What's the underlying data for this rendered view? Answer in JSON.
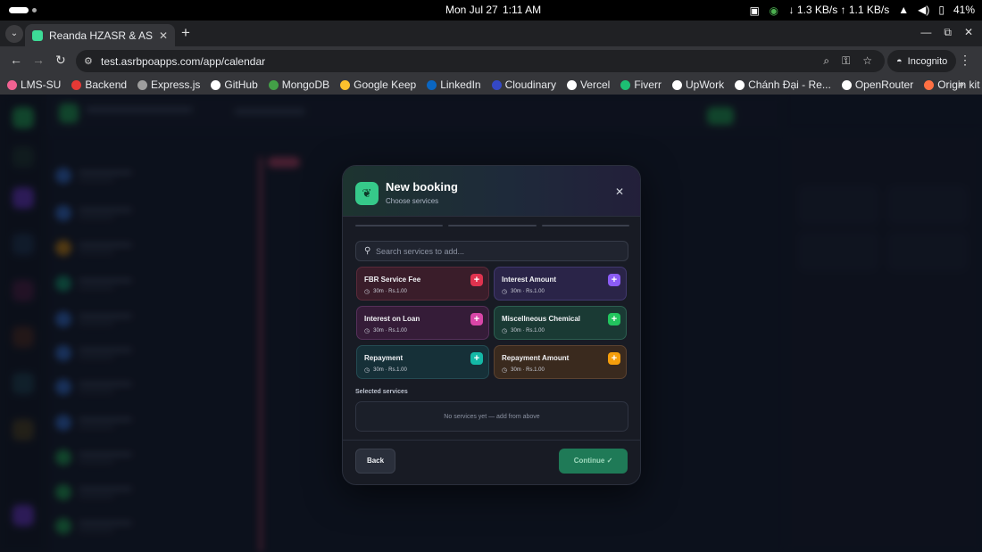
{
  "os": {
    "date": "Mon Jul 27",
    "time": "1:11 AM",
    "network": "↓ 1.3 KB/s ↑ 1.1 KB/s",
    "battery": "41%"
  },
  "browser": {
    "tab_title": "Reanda HZASR & ASR BP",
    "url": "test.asrbpoapps.com/app/calendar",
    "incognito_label": "Incognito",
    "bookmarks": [
      {
        "label": "LMS-SU",
        "color": "#f06292"
      },
      {
        "label": "Backend",
        "color": "#e53935"
      },
      {
        "label": "Express.js",
        "color": "#9e9e9e"
      },
      {
        "label": "GitHub",
        "color": "#ffffff"
      },
      {
        "label": "MongoDB",
        "color": "#43a047"
      },
      {
        "label": "Google Keep",
        "color": "#fbc02d"
      },
      {
        "label": "LinkedIn",
        "color": "#0a66c2"
      },
      {
        "label": "Cloudinary",
        "color": "#3448c5"
      },
      {
        "label": "Vercel",
        "color": "#ffffff"
      },
      {
        "label": "Fiverr",
        "color": "#1dbf73"
      },
      {
        "label": "UpWork",
        "color": "#ffffff"
      },
      {
        "label": "Chánh Đại - Re...",
        "color": "#ffffff"
      },
      {
        "label": "OpenRouter",
        "color": "#ffffff"
      },
      {
        "label": "Origin kit",
        "color": "#ff7043"
      }
    ]
  },
  "modal": {
    "title": "New booking",
    "subtitle": "Choose services",
    "search_placeholder": "Search services to add...",
    "services": [
      {
        "name": "FBR Service Fee",
        "meta": "30m · Rs.1.00",
        "accent": "#e0334f",
        "bg": "#3a1d2a",
        "border": "#5a2a3a"
      },
      {
        "name": "Interest Amount",
        "meta": "30m · Rs.1.00",
        "accent": "#8b5cf6",
        "bg": "#2a2448",
        "border": "#41386e"
      },
      {
        "name": "Interest on Loan",
        "meta": "30m · Rs.1.00",
        "accent": "#d946a8",
        "bg": "#351c38",
        "border": "#56305a"
      },
      {
        "name": "Miscellneous Chemical",
        "meta": "30m · Rs.1.00",
        "accent": "#22c55e",
        "bg": "#1a3a34",
        "border": "#2c5e50"
      },
      {
        "name": "Repayment",
        "meta": "30m · Rs.1.00",
        "accent": "#14b8a6",
        "bg": "#163038",
        "border": "#244a52"
      },
      {
        "name": "Repayment Amount",
        "meta": "30m · Rs.1.00",
        "accent": "#f59e0b",
        "bg": "#3a2a1e",
        "border": "#5a4230"
      }
    ],
    "selected_label": "Selected services",
    "selected_empty": "No services yet — add from above",
    "back_label": "Back",
    "continue_label": "Continue ✓"
  }
}
